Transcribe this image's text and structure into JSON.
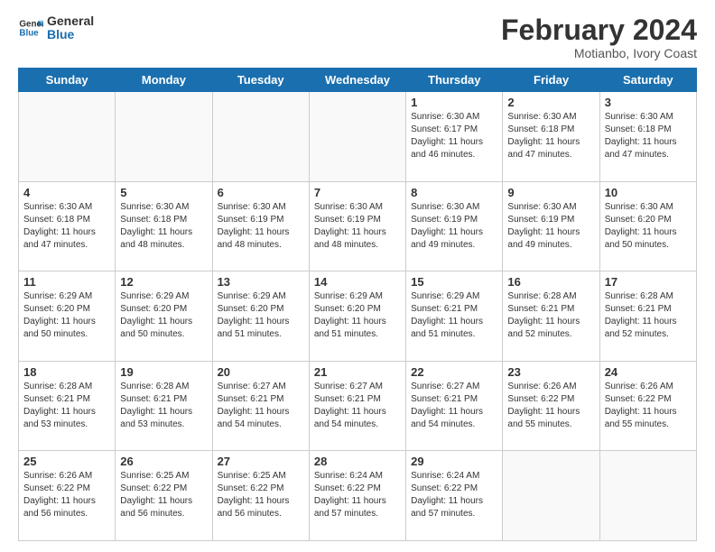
{
  "header": {
    "logo_line1": "General",
    "logo_line2": "Blue",
    "month_year": "February 2024",
    "location": "Motianbo, Ivory Coast"
  },
  "days_of_week": [
    "Sunday",
    "Monday",
    "Tuesday",
    "Wednesday",
    "Thursday",
    "Friday",
    "Saturday"
  ],
  "weeks": [
    [
      {
        "day": "",
        "info": ""
      },
      {
        "day": "",
        "info": ""
      },
      {
        "day": "",
        "info": ""
      },
      {
        "day": "",
        "info": ""
      },
      {
        "day": "1",
        "info": "Sunrise: 6:30 AM\nSunset: 6:17 PM\nDaylight: 11 hours\nand 46 minutes."
      },
      {
        "day": "2",
        "info": "Sunrise: 6:30 AM\nSunset: 6:18 PM\nDaylight: 11 hours\nand 47 minutes."
      },
      {
        "day": "3",
        "info": "Sunrise: 6:30 AM\nSunset: 6:18 PM\nDaylight: 11 hours\nand 47 minutes."
      }
    ],
    [
      {
        "day": "4",
        "info": "Sunrise: 6:30 AM\nSunset: 6:18 PM\nDaylight: 11 hours\nand 47 minutes."
      },
      {
        "day": "5",
        "info": "Sunrise: 6:30 AM\nSunset: 6:18 PM\nDaylight: 11 hours\nand 48 minutes."
      },
      {
        "day": "6",
        "info": "Sunrise: 6:30 AM\nSunset: 6:19 PM\nDaylight: 11 hours\nand 48 minutes."
      },
      {
        "day": "7",
        "info": "Sunrise: 6:30 AM\nSunset: 6:19 PM\nDaylight: 11 hours\nand 48 minutes."
      },
      {
        "day": "8",
        "info": "Sunrise: 6:30 AM\nSunset: 6:19 PM\nDaylight: 11 hours\nand 49 minutes."
      },
      {
        "day": "9",
        "info": "Sunrise: 6:30 AM\nSunset: 6:19 PM\nDaylight: 11 hours\nand 49 minutes."
      },
      {
        "day": "10",
        "info": "Sunrise: 6:30 AM\nSunset: 6:20 PM\nDaylight: 11 hours\nand 50 minutes."
      }
    ],
    [
      {
        "day": "11",
        "info": "Sunrise: 6:29 AM\nSunset: 6:20 PM\nDaylight: 11 hours\nand 50 minutes."
      },
      {
        "day": "12",
        "info": "Sunrise: 6:29 AM\nSunset: 6:20 PM\nDaylight: 11 hours\nand 50 minutes."
      },
      {
        "day": "13",
        "info": "Sunrise: 6:29 AM\nSunset: 6:20 PM\nDaylight: 11 hours\nand 51 minutes."
      },
      {
        "day": "14",
        "info": "Sunrise: 6:29 AM\nSunset: 6:20 PM\nDaylight: 11 hours\nand 51 minutes."
      },
      {
        "day": "15",
        "info": "Sunrise: 6:29 AM\nSunset: 6:21 PM\nDaylight: 11 hours\nand 51 minutes."
      },
      {
        "day": "16",
        "info": "Sunrise: 6:28 AM\nSunset: 6:21 PM\nDaylight: 11 hours\nand 52 minutes."
      },
      {
        "day": "17",
        "info": "Sunrise: 6:28 AM\nSunset: 6:21 PM\nDaylight: 11 hours\nand 52 minutes."
      }
    ],
    [
      {
        "day": "18",
        "info": "Sunrise: 6:28 AM\nSunset: 6:21 PM\nDaylight: 11 hours\nand 53 minutes."
      },
      {
        "day": "19",
        "info": "Sunrise: 6:28 AM\nSunset: 6:21 PM\nDaylight: 11 hours\nand 53 minutes."
      },
      {
        "day": "20",
        "info": "Sunrise: 6:27 AM\nSunset: 6:21 PM\nDaylight: 11 hours\nand 54 minutes."
      },
      {
        "day": "21",
        "info": "Sunrise: 6:27 AM\nSunset: 6:21 PM\nDaylight: 11 hours\nand 54 minutes."
      },
      {
        "day": "22",
        "info": "Sunrise: 6:27 AM\nSunset: 6:21 PM\nDaylight: 11 hours\nand 54 minutes."
      },
      {
        "day": "23",
        "info": "Sunrise: 6:26 AM\nSunset: 6:22 PM\nDaylight: 11 hours\nand 55 minutes."
      },
      {
        "day": "24",
        "info": "Sunrise: 6:26 AM\nSunset: 6:22 PM\nDaylight: 11 hours\nand 55 minutes."
      }
    ],
    [
      {
        "day": "25",
        "info": "Sunrise: 6:26 AM\nSunset: 6:22 PM\nDaylight: 11 hours\nand 56 minutes."
      },
      {
        "day": "26",
        "info": "Sunrise: 6:25 AM\nSunset: 6:22 PM\nDaylight: 11 hours\nand 56 minutes."
      },
      {
        "day": "27",
        "info": "Sunrise: 6:25 AM\nSunset: 6:22 PM\nDaylight: 11 hours\nand 56 minutes."
      },
      {
        "day": "28",
        "info": "Sunrise: 6:24 AM\nSunset: 6:22 PM\nDaylight: 11 hours\nand 57 minutes."
      },
      {
        "day": "29",
        "info": "Sunrise: 6:24 AM\nSunset: 6:22 PM\nDaylight: 11 hours\nand 57 minutes."
      },
      {
        "day": "",
        "info": ""
      },
      {
        "day": "",
        "info": ""
      }
    ]
  ]
}
